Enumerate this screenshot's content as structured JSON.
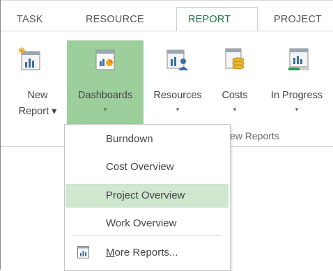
{
  "tabs": {
    "task": "TASK",
    "resource": "RESOURCE",
    "report": "REPORT",
    "project": "PROJECT"
  },
  "ribbon": {
    "new_report": {
      "line1": "New",
      "line2": "Report ▾"
    },
    "dashboards": {
      "line1": "Dashboards",
      "line2": "▾"
    },
    "resources": {
      "line1": "Resources",
      "line2": "▾"
    },
    "costs": {
      "line1": "Costs",
      "line2": "▾"
    },
    "in_progress": {
      "line1": "In Progress",
      "line2": "▾"
    },
    "group_label_partial": "ew Reports"
  },
  "menu": {
    "items": [
      {
        "label": "Burndown"
      },
      {
        "label": "Cost Overview"
      },
      {
        "label": "Project Overview",
        "highlighted": true
      },
      {
        "label": "Work Overview"
      }
    ],
    "more_reports": {
      "label_first": "M",
      "label_rest": "ore Reports..."
    }
  },
  "colors": {
    "active_tab_text": "#217346",
    "selected_button_bg": "#9ccf9c",
    "menu_highlight_bg": "#cfe6cf"
  }
}
